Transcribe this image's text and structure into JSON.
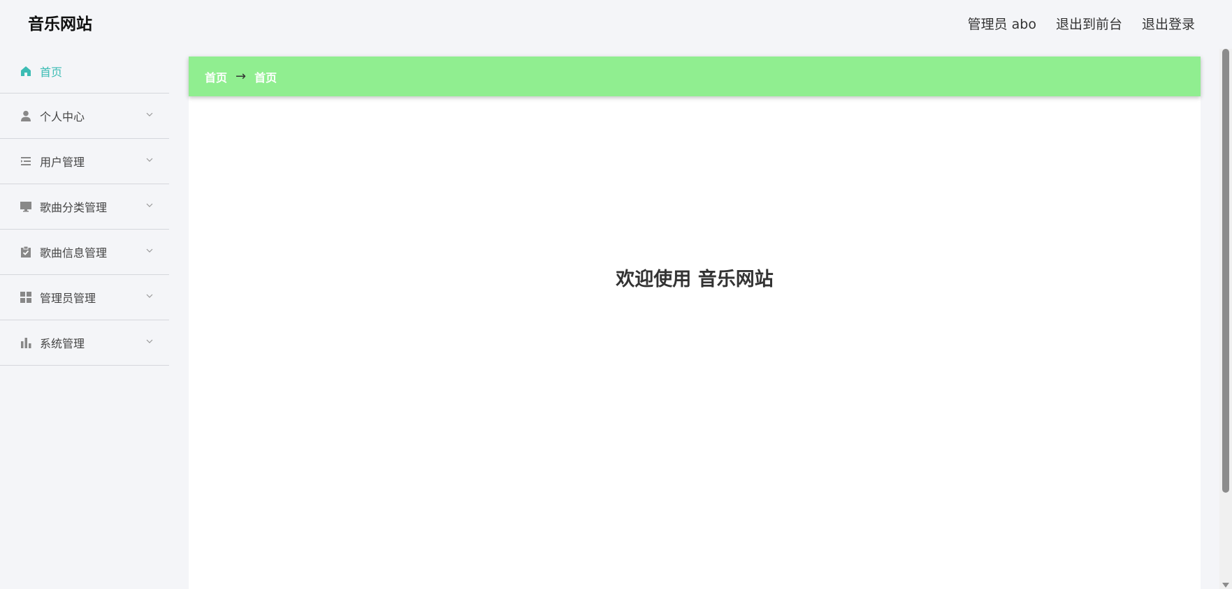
{
  "header": {
    "site_title": "音乐网站",
    "user_label": "管理员 abo",
    "front_link": "退出到前台",
    "logout_link": "退出登录"
  },
  "sidebar": {
    "items": [
      {
        "label": "首页",
        "icon": "home-icon",
        "active": true
      },
      {
        "label": "个人中心",
        "icon": "person-icon"
      },
      {
        "label": "用户管理",
        "icon": "list-icon"
      },
      {
        "label": "歌曲分类管理",
        "icon": "monitor-icon"
      },
      {
        "label": "歌曲信息管理",
        "icon": "clipboard-icon"
      },
      {
        "label": "管理员管理",
        "icon": "grid-icon"
      },
      {
        "label": "系统管理",
        "icon": "bar-chart-icon"
      }
    ]
  },
  "breadcrumb": {
    "root": "首页",
    "separator": "→",
    "current": "首页"
  },
  "main": {
    "welcome_text": "欢迎使用 音乐网站"
  },
  "colors": {
    "accent": "#3cbcb4",
    "breadcrumb_bg": "#90ee90"
  }
}
